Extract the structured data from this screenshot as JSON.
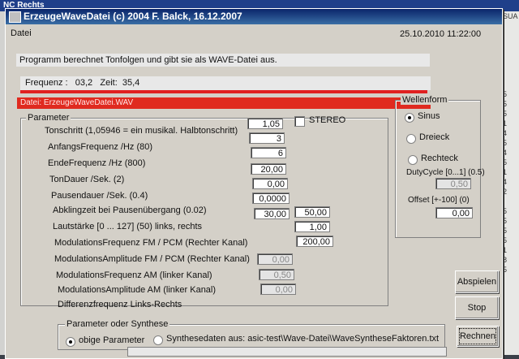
{
  "background": {
    "title": "NC Rechts",
    "side_items": [
      "SUA",
      "",
      "",
      "",
      "",
      "",
      "",
      "",
      "5",
      "5",
      "5",
      "1",
      "4",
      "5",
      "4",
      "5",
      "1",
      "4",
      "2",
      "",
      "5",
      "5",
      "5",
      "5",
      "1",
      "8",
      "5"
    ]
  },
  "window": {
    "title": "ErzeugeWaveDatei (c) 2004 F. Balck,   16.12.2007",
    "menu": "Datei",
    "datetime": "25.10.2010 11:22:00"
  },
  "banner": "Programm berechnet Tonfolgen und gibt sie als WAVE-Datei aus.",
  "status": {
    "frequenz_label": "Frequenz :",
    "frequenz_value": "03,2",
    "zeit_label": "Zeit:",
    "zeit_value": "35,4",
    "datei": "Datei: ErzeugeWaveDatei.WAV"
  },
  "parameter": {
    "title": "Parameter",
    "stereo_label": "STEREO",
    "rows": [
      {
        "label": "Tonschritt (1,05946 = ein musikal. Halbtonschritt)",
        "value": "1,05"
      },
      {
        "label": "AnfangsFrequenz /Hz (80)",
        "value": "3"
      },
      {
        "label": "EndeFrequenz /Hz (800)",
        "value": "6"
      },
      {
        "label": "TonDauer /Sek. (2)",
        "value": "20,00"
      },
      {
        "label": "Pausendauer /Sek. (0.4)",
        "value": "0,00"
      },
      {
        "label": "Abklingzeit bei Pausenübergang    (0.02)",
        "value": "0,0000"
      },
      {
        "label": "Lautstärke [0 ... 127] (50)    links, rechts",
        "value": "30,00",
        "value2": "50,00"
      },
      {
        "label": "ModulationsFrequenz FM / PCM (Rechter Kanal)",
        "value2": "1,00"
      },
      {
        "label": "ModulationsAmplitude FM / PCM (Rechter Kanal)",
        "value2": "200,00"
      },
      {
        "label": "ModulationsFrequenz AM  (linker Kanal)",
        "value": "0,00"
      },
      {
        "label": "ModulationsAmplitude AM  (linker Kanal)",
        "value": "0,50"
      },
      {
        "label": "Differenzfrequenz Links-Rechts",
        "value": "0,00"
      }
    ]
  },
  "wellenform": {
    "title": "Wellenform",
    "options": [
      "Sinus",
      "Dreieck",
      "Rechteck"
    ],
    "selected": "Sinus",
    "duty_label": "DutyCycle [0...1]   (0.5)",
    "duty_value": "0,50",
    "offset_label": "Offset [+-100]     (0)",
    "offset_value": "0,00"
  },
  "buttons": {
    "abspielen": "Abspielen",
    "stop": "Stop",
    "rechnen": "Rechnen"
  },
  "synthese": {
    "title": "Parameter oder Synthese",
    "opt1": "obige Parameter",
    "opt2": "Synthesedaten aus: asic-test\\Wave-Datei\\WaveSyntheseFaktoren.txt",
    "selected": "obige Parameter"
  }
}
